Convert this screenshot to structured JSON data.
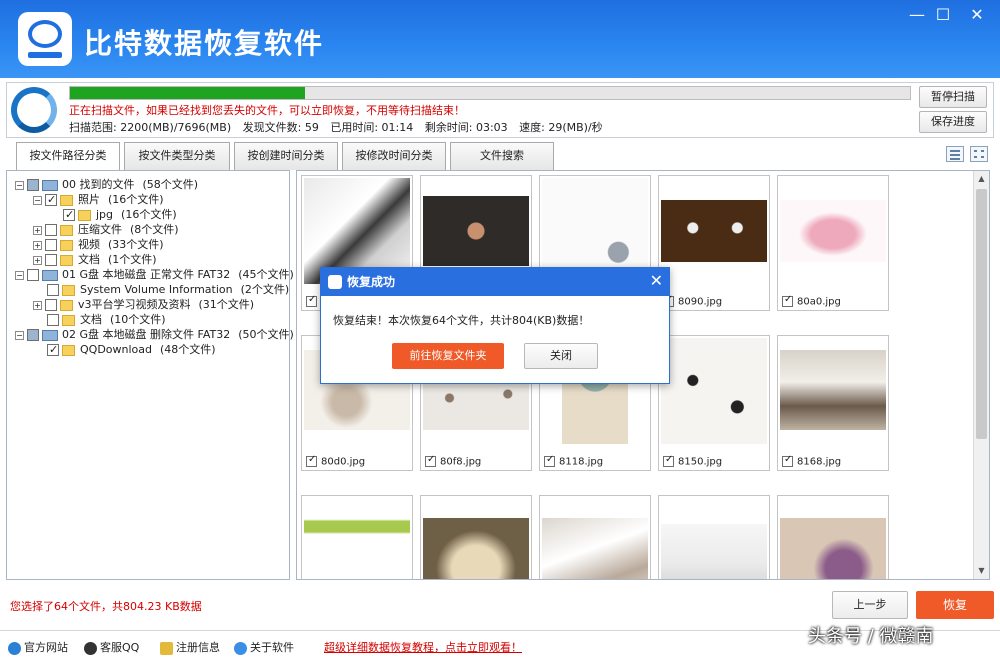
{
  "app": {
    "title": "比特数据恢复软件"
  },
  "window": {
    "minimize": "—",
    "maximize": "☐",
    "close": "✕"
  },
  "scan": {
    "progress_percent": 28,
    "message": "正在扫描文件，如果已经找到您丢失的文件，可以立即恢复，不用等待扫描结束！",
    "range": "扫描范围: 2200(MB)/7696(MB)",
    "found": "发现文件数: 59",
    "elapsed": "已用时间: 01:14",
    "remaining": "剩余时间: 03:03",
    "speed": "速度: 29(MB)/秒",
    "pause_label": "暂停扫描",
    "save_label": "保存进度"
  },
  "tabs": [
    "按文件路径分类",
    "按文件类型分类",
    "按创建时间分类",
    "按修改时间分类",
    "文件搜索"
  ],
  "tree": [
    {
      "label": "00 找到的文件",
      "count": "(58个文件)"
    },
    {
      "label": "照片",
      "count": "(16个文件)"
    },
    {
      "label": "jpg",
      "count": "(16个文件)"
    },
    {
      "label": "压缩文件",
      "count": "(8个文件)"
    },
    {
      "label": "视频",
      "count": "(33个文件)"
    },
    {
      "label": "文档",
      "count": "(1个文件)"
    },
    {
      "label": "01 G盘 本地磁盘 正常文件 FAT32",
      "count": "(45个文件)"
    },
    {
      "label": "System Volume Information",
      "count": "(2个文件)"
    },
    {
      "label": "v3平台学习视频及资料",
      "count": "(31个文件)"
    },
    {
      "label": "文档",
      "count": "(10个文件)"
    },
    {
      "label": "02 G盘 本地磁盘 删除文件 FAT32",
      "count": "(50个文件)"
    },
    {
      "label": "QQDownload",
      "count": "(48个文件)"
    }
  ],
  "thumbnails": [
    {
      "name": ""
    },
    {
      "name": ""
    },
    {
      "name": ""
    },
    {
      "name": "8090.jpg"
    },
    {
      "name": "80a0.jpg"
    },
    {
      "name": "80d0.jpg"
    },
    {
      "name": "80f8.jpg"
    },
    {
      "name": "8118.jpg"
    },
    {
      "name": "8150.jpg"
    },
    {
      "name": "8168.jpg"
    },
    {
      "name": ""
    },
    {
      "name": ""
    },
    {
      "name": ""
    },
    {
      "name": ""
    },
    {
      "name": ""
    }
  ],
  "dialog": {
    "title": "恢复成功",
    "message": "恢复结束！本次恢复64个文件，共计804(KB)数据！",
    "open_folder": "前往恢复文件夹",
    "close": "关闭"
  },
  "bottom": {
    "selection": "您选择了64个文件，共804.23 KB数据",
    "prev": "上一步",
    "recover": "恢复"
  },
  "footer": {
    "website": "官方网站",
    "support": "客服QQ",
    "register": "注册信息",
    "about": "关于软件",
    "promo": "超级详细数据恢复教程，点击立即观看！",
    "watermark": "头条号 / 微赣南"
  },
  "colors": {
    "titlebar": "#2a86f0",
    "accent": "#ef5a28",
    "progress": "#1fa421",
    "alert_text": "#d40000"
  }
}
